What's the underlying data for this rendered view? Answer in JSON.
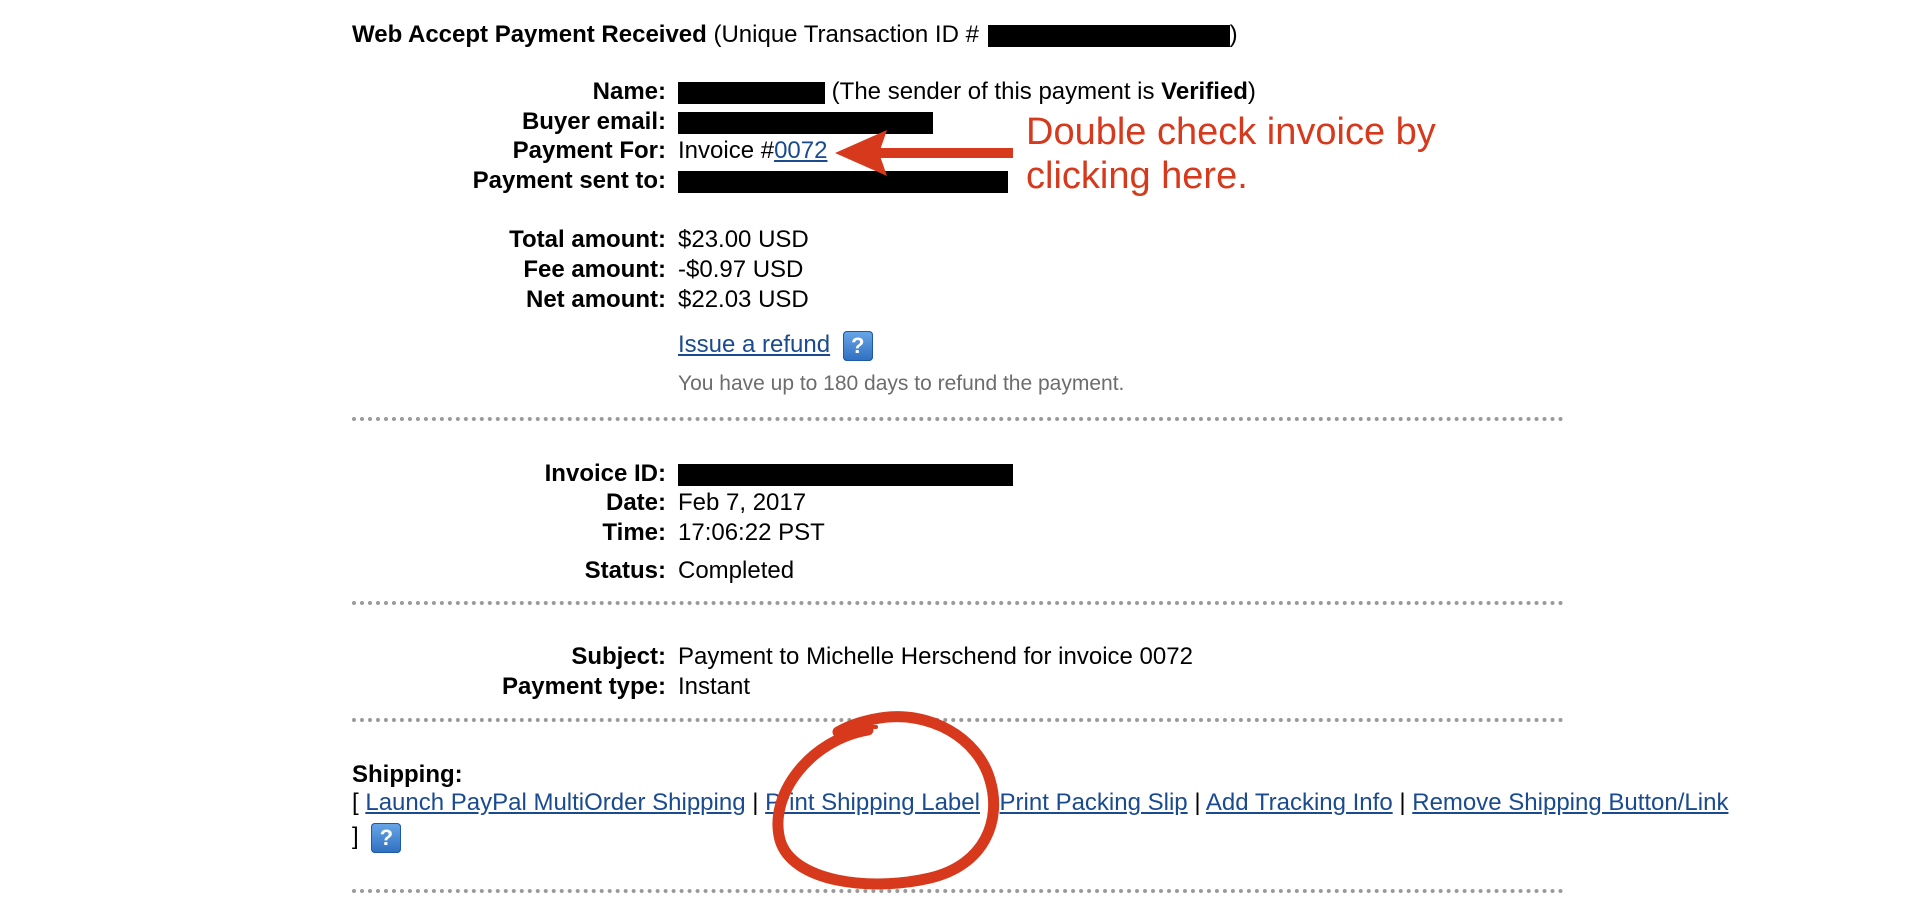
{
  "header": {
    "title": "Web Accept Payment Received",
    "txn_prefix": "(Unique Transaction ID #",
    "txn_suffix": ")"
  },
  "payer": {
    "name_label": "Name:",
    "sender_note_prefix": "(The sender of this payment is",
    "sender_status": "Verified",
    "sender_note_suffix": ")",
    "email_label": "Buyer email:",
    "payment_for_label": "Payment For:",
    "invoice_prefix": "Invoice #",
    "invoice_number": "0072",
    "sent_to_label": "Payment sent to:"
  },
  "amounts": {
    "total_label": "Total amount:",
    "total_value": "$23.00 USD",
    "fee_label": "Fee amount:",
    "fee_value": "-$0.97 USD",
    "net_label": "Net amount:",
    "net_value": "$22.03 USD",
    "refund_link": "Issue a refund",
    "refund_note": "You have up to 180 days to refund the payment."
  },
  "invoice": {
    "id_label": "Invoice ID:",
    "date_label": "Date:",
    "date_value": "Feb 7, 2017",
    "time_label": "Time:",
    "time_value": "17:06:22 PST",
    "status_label": "Status:",
    "status_value": "Completed"
  },
  "details": {
    "subject_label": "Subject:",
    "subject_value": "Payment to Michelle Herschend for invoice 0072",
    "type_label": "Payment type:",
    "type_value": "Instant"
  },
  "shipping": {
    "title": "Shipping:",
    "open_bracket": "[",
    "close_bracket": "]",
    "separator": "|",
    "links": [
      "Launch PayPal MultiOrder Shipping",
      "Print Shipping Label",
      "Print Packing Slip",
      "Add Tracking Info",
      "Remove Shipping Button/Link"
    ]
  },
  "annotation": {
    "line1": "Double check invoice by",
    "line2": "clicking here."
  },
  "colors": {
    "link": "#1a4a8f",
    "annotation": "#d6391c",
    "divider": "#9a9a9a",
    "muted_text": "#6c6c6c"
  },
  "icons": {
    "help": "help-question-icon",
    "arrow": "left-arrow-icon",
    "circle": "circle-highlight-icon"
  }
}
